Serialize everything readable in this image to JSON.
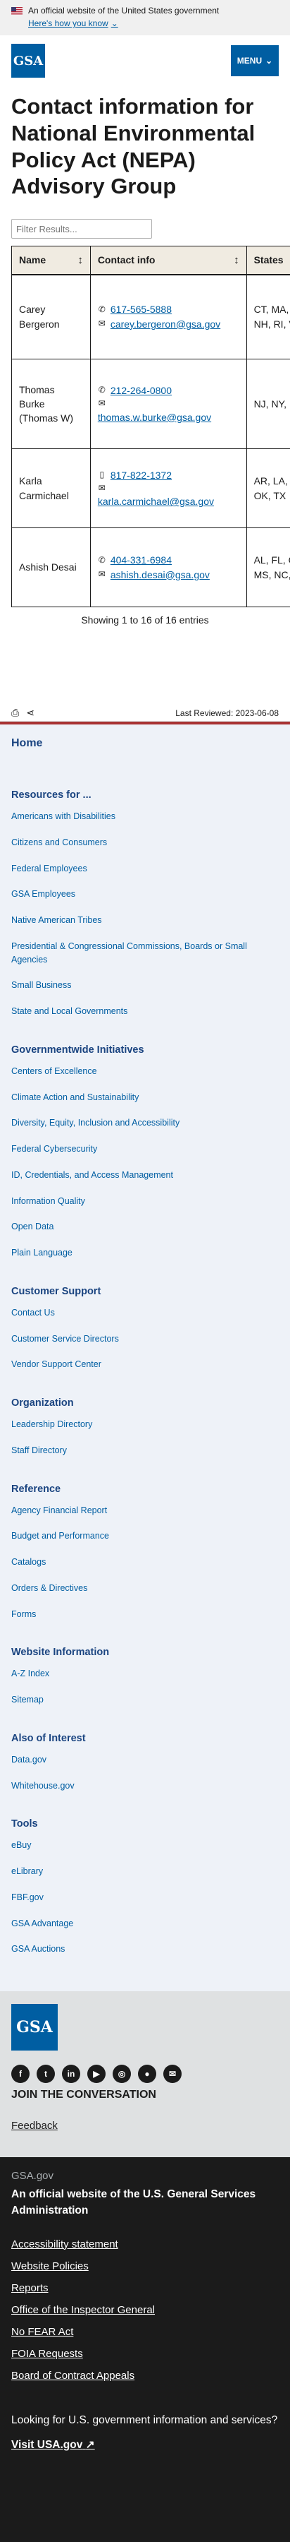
{
  "banner": {
    "official_text": "An official website of the United States government",
    "how_know": "Here's how you know"
  },
  "header": {
    "logo_text": "GSA",
    "menu_label": "MENU"
  },
  "page": {
    "title": "Contact information for National Environmental Policy Act (NEPA) Advisory Group"
  },
  "filter": {
    "placeholder": "Filter Results..."
  },
  "table": {
    "headers": [
      "Name",
      "Contact info",
      "States"
    ],
    "rows": [
      {
        "name": "Carey Bergeron",
        "phone": "617-565-5888",
        "email": "carey.bergeron@gsa.gov",
        "states": "CT, MA, ME, NH, RI, VT"
      },
      {
        "name": "Thomas Burke (Thomas W)",
        "phone": "212-264-0800",
        "email": "thomas.w.burke@gsa.gov",
        "states": "NJ, NY, PR, VI"
      },
      {
        "name": "Karla Carmichael",
        "phone": "817-822-1372",
        "email": "karla.carmichael@gsa.gov",
        "states": "AR, LA, NM, OK, TX"
      },
      {
        "name": "Ashish Desai",
        "phone": "404-331-6984",
        "email": "ashish.desai@gsa.gov",
        "states": "AL, FL, GA, KY, MS, NC, SC, TN"
      }
    ],
    "showing": "Showing 1 to 16 of 16 entries"
  },
  "page_tools": {
    "last_reviewed": "Last Reviewed: 2023-06-08"
  },
  "footer_nav": {
    "home": "Home",
    "groups": [
      {
        "heading": "Resources for ...",
        "items": [
          "Americans with Disabilities",
          "Citizens and Consumers",
          "Federal Employees",
          "GSA Employees",
          "Native American Tribes",
          "Presidential & Congressional Commissions, Boards or Small Agencies",
          "Small Business",
          "State and Local Governments"
        ]
      },
      {
        "heading": "Governmentwide Initiatives",
        "items": [
          "Centers of Excellence",
          "Climate Action and Sustainability",
          "Diversity, Equity, Inclusion and Accessibility",
          "Federal Cybersecurity",
          "ID, Credentials, and Access Management",
          "Information Quality",
          "Open Data",
          "Plain Language"
        ]
      },
      {
        "heading": "Customer Support",
        "items": [
          "Contact Us",
          "Customer Service Directors",
          "Vendor Support Center"
        ]
      },
      {
        "heading": "Organization",
        "items": [
          "Leadership Directory",
          "Staff Directory"
        ]
      },
      {
        "heading": "Reference",
        "items": [
          "Agency Financial Report",
          "Budget and Performance",
          "Catalogs",
          "Orders & Directives",
          "Forms"
        ]
      },
      {
        "heading": "Website Information",
        "items": [
          "A-Z Index",
          "Sitemap"
        ]
      },
      {
        "heading": "Also of Interest",
        "items": [
          "Data.gov",
          "Whitehouse.gov"
        ]
      },
      {
        "heading": "Tools",
        "items": [
          "eBuy",
          "eLibrary",
          "FBF.gov",
          "GSA Advantage",
          "GSA Auctions"
        ]
      }
    ]
  },
  "social": {
    "logo_text": "GSA",
    "join": "JOIN THE CONVERSATION",
    "feedback": "Feedback",
    "icons": [
      "facebook-icon",
      "twitter-icon",
      "linkedin-icon",
      "youtube-icon",
      "instagram-icon",
      "flickr-icon",
      "email-icon"
    ]
  },
  "identifier": {
    "domain": "GSA.gov",
    "official": "An official website of the U.S. General Services Administration",
    "links": [
      "Accessibility statement",
      "Website Policies",
      "Reports",
      "Office of the Inspector General",
      "No FEAR Act",
      "FOIA Requests",
      "Board of Contract Appeals"
    ],
    "looking": "Looking for U.S. government information and services?",
    "visit": "Visit USA.gov"
  },
  "colors": {
    "primary": "#005ea2",
    "footer_border": "#a83232",
    "footer_bg": "#eef2f8",
    "identifier_bg": "#1b1b1b"
  }
}
